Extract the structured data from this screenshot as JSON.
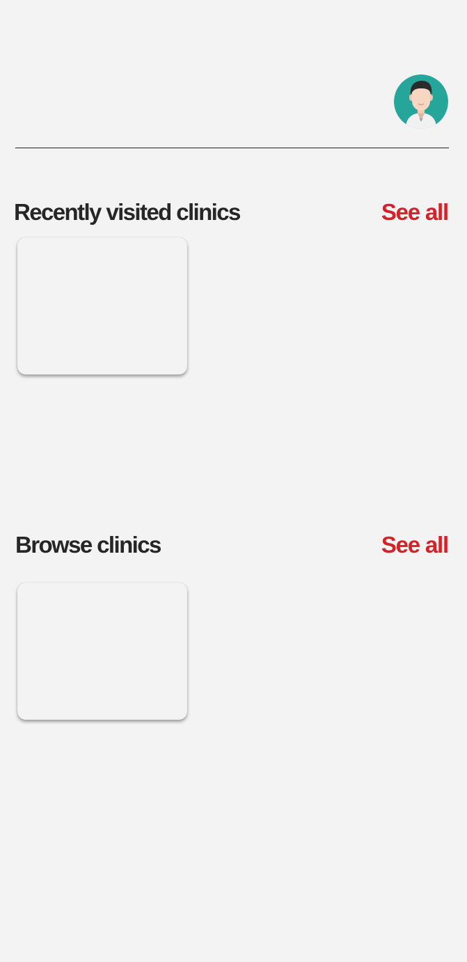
{
  "header": {
    "avatar": {
      "icon": "doctor-avatar-icon",
      "background_color": "#26a69a"
    }
  },
  "sections": {
    "recent": {
      "title": "Recently visited clinics",
      "see_all_label": "See all",
      "cards": [
        {}
      ]
    },
    "browse": {
      "title": "Browse clinics",
      "see_all_label": "See all",
      "cards": [
        {}
      ]
    }
  },
  "colors": {
    "background": "#f3f3f3",
    "accent": "#d3232a",
    "heading": "#262626"
  }
}
